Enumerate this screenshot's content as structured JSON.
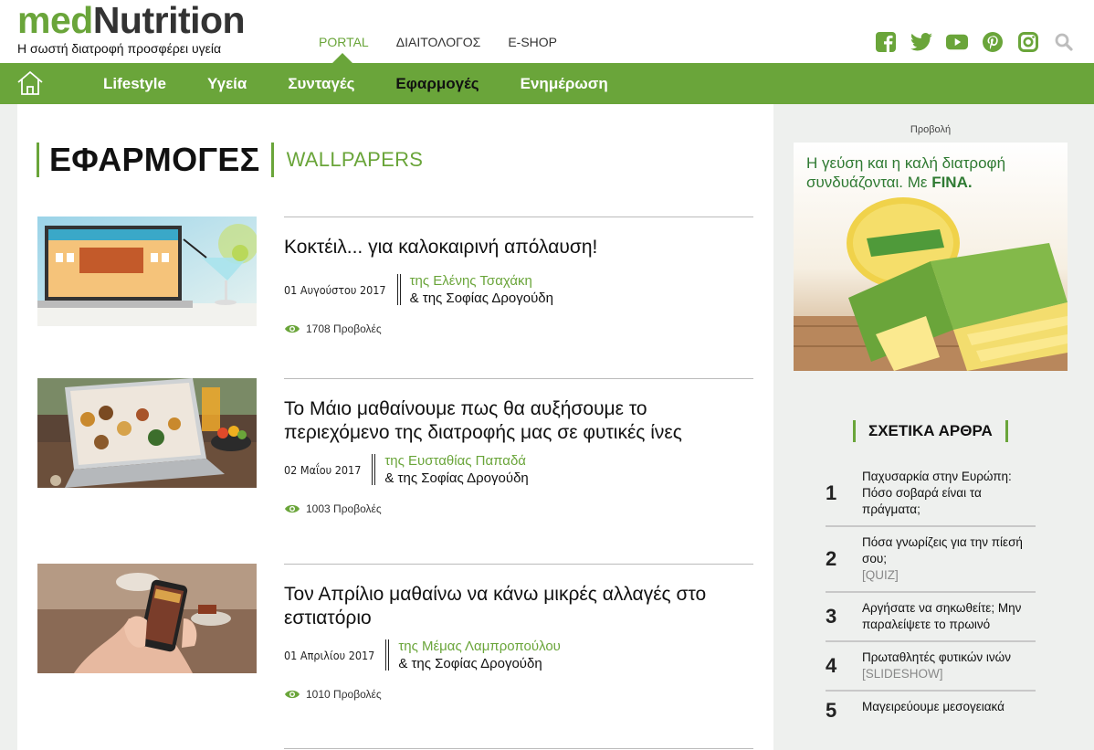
{
  "header": {
    "logo_med": "med",
    "logo_nut": "Nutrition",
    "tagline": "Η σωστή διατροφή προσφέρει υγεία",
    "topnav": [
      "PORTAL",
      "ΔΙΑΙΤΟΛΟΓΟΣ",
      "E-SHOP"
    ],
    "social_icons": [
      "facebook-icon",
      "twitter-icon",
      "youtube-icon",
      "pinterest-icon",
      "instagram-icon",
      "search-icon"
    ],
    "accent_color": "#6aa53a"
  },
  "mainnav": {
    "items": [
      "Lifestyle",
      "Υγεία",
      "Συνταγές",
      "Εφαρμογές",
      "Ενημέρωση"
    ],
    "current": "Εφαρμογές"
  },
  "section": {
    "title": "ΕΦΑΡΜΟΓΕΣ",
    "subtitle": "WALLPAPERS"
  },
  "articles": [
    {
      "title": "Κοκτέιλ... για καλοκαιρινή απόλαυση!",
      "date": "01 Αυγούστου 2017",
      "author1": "της Ελένης Τσαχάκη",
      "author2": "& της Σοφίας Δρογούδη",
      "views": "1708 Προβολές"
    },
    {
      "title": "Το Μάιο μαθαίνουμε πως θα αυξήσουμε το περιεχόμενο της διατροφής μας σε φυτικές ίνες",
      "date": "02 Μαΐου 2017",
      "author1": "της Ευσταθίας Παπαδά",
      "author2": "& της Σοφίας Δρογούδη",
      "views": "1003 Προβολές"
    },
    {
      "title": "Τον Απρίλιο μαθαίνω να κάνω μικρές αλλαγές στο εστιατόριο",
      "date": "01 Απριλίου 2017",
      "author1": "της Μέμας Λαμπροπούλου",
      "author2": "& της Σοφίας Δρογούδη",
      "views": "1010 Προβολές"
    }
  ],
  "sidebar": {
    "ad_label": "Προβολή",
    "ad_line1": "Η γεύση και η καλή διατροφή",
    "ad_line2": "συνδυάζονται. Με ",
    "ad_brand": "FINA.",
    "related_title": "ΣΧΕΤΙΚΑ ΑΡΘΡΑ",
    "related": [
      {
        "num": "1",
        "text": "Παχυσαρκία στην Ευρώπη: Πόσο σοβαρά είναι τα πράγματα;",
        "tag": ""
      },
      {
        "num": "2",
        "text": "Πόσα γνωρίζεις για την πίεσή σου;",
        "tag": "[QUIZ]"
      },
      {
        "num": "3",
        "text": "Αργήσατε να σηκωθείτε; Μην παραλείψετε το πρωινό",
        "tag": ""
      },
      {
        "num": "4",
        "text": "Πρωταθλητές φυτικών ινών",
        "tag": "[SLIDESHOW]"
      },
      {
        "num": "5",
        "text": "Μαγειρεύουμε μεσογειακά",
        "tag": ""
      }
    ]
  }
}
